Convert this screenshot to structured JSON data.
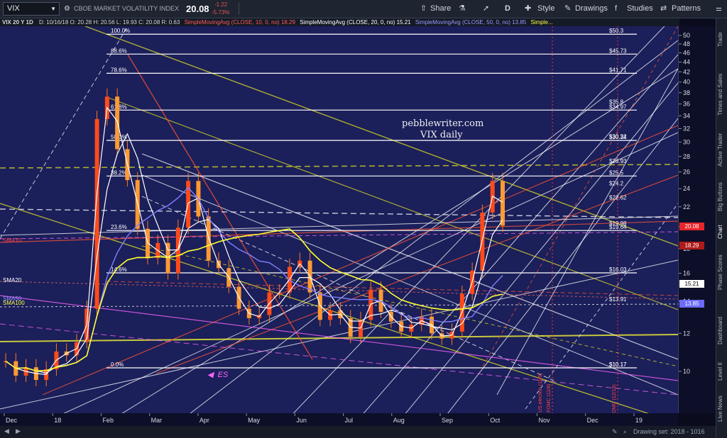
{
  "toolbar": {
    "symbol": "VIX",
    "description": "CBOE MARKET VOLATILITY INDEX",
    "last": "20.08",
    "change": "-1.22",
    "change_pct": "-5.73%",
    "share_label": "Share",
    "interval": "D",
    "style_label": "Style",
    "drawings_label": "Drawings",
    "studies_label": "Studies",
    "patterns_label": "Patterns"
  },
  "info_bar": {
    "chart_id": "VIX 20 Y 1D",
    "ohlc": "D: 10/16/18  O: 20.28  H: 20.56  L: 19.93  C: 20.08  R: 0.63",
    "sma10_label": "SimpleMovingAvg (CLOSE, 10, 0, no)",
    "sma10_value": "18.29",
    "sma20_label": "SimpleMovingAvg (CLOSE, 20, 0, no)",
    "sma20_value": "15.21",
    "sma50_label": "SimpleMovingAvg (CLOSE, 50, 0, no)",
    "sma50_value": "13.85",
    "sma100_label": "Simple..."
  },
  "watermark": {
    "line1": "pebblewriter.com",
    "line2": "VIX daily"
  },
  "price_tags": {
    "close": "20.08",
    "sma10": "18.29",
    "sma20": "15.21",
    "sma50": "13.85"
  },
  "sma_labels": [
    "SMA10",
    "SMA20",
    "SMA50",
    "SMA100"
  ],
  "fib_left": [
    "100.0%",
    "88.6%",
    "78.6%",
    "61.8%",
    "50.0%",
    "38.2%",
    "23.6%",
    "14.6%",
    "0.0%"
  ],
  "fib_right": [
    "$50.3",
    "$45.73",
    "$41.71",
    "$35.8",
    "$34.97",
    "$30.32",
    "$30.24",
    "$26.93",
    "$25.5",
    "$24.2",
    "$22.62",
    "$19.98",
    "$19.64",
    "$16.03",
    "$13.91",
    "$10.17",
    "$10.17"
  ],
  "annotations": {
    "es": "ES",
    "fomc1": "FOMC (11/8)",
    "fomc2": "FOMC (12/19)",
    "election": "US election (11/6)"
  },
  "bottom": {
    "drawing_set": "Drawing set: 2018 - 1016"
  },
  "sidebar": [
    "Trade",
    "Times and Sales",
    "Active Trader",
    "Big Buttons",
    "Chart",
    "Phase Scores",
    "Dashboard",
    "Level II",
    "Live News"
  ],
  "colors": {
    "background": "#1b1f5a",
    "candle_up": "#ff4a1a",
    "candle_down": "#ff7a1a",
    "sma10": "#ffffff",
    "sma20": "#ffffff",
    "sma50": "#8080ff",
    "sma100": "#ffff33",
    "fib": "#ffffff",
    "channel_yellow": "#dddd22",
    "channel_red": "#ff5533",
    "magenta": "#ff66ff"
  },
  "chart_data": {
    "type": "line",
    "title": "VIX 20 Y 1D",
    "ylim": [
      2,
      51
    ],
    "y_ticks": [
      50,
      48,
      46,
      44,
      42,
      40,
      38,
      36,
      34,
      32,
      30,
      28,
      26,
      24,
      22,
      20,
      18,
      16,
      14,
      12,
      10
    ],
    "y_scale": "log",
    "x_ticks": [
      "Dec",
      "18",
      "Feb",
      "Mar",
      "Apr",
      "May",
      "Jun",
      "Jul",
      "Aug",
      "Sep",
      "Oct",
      "Nov",
      "Dec",
      "19"
    ],
    "series": [
      {
        "name": "VIX",
        "values": [
          10.5,
          9.8,
          10.2,
          9.6,
          10.1,
          11.0,
          10.8,
          11.5,
          13.5,
          33.5,
          37.3,
          29.0,
          25.0,
          19.8,
          17.2,
          18.5,
          16.0,
          19.9,
          24.9,
          21.0,
          17.0,
          16.4,
          15.0,
          13.5,
          12.9,
          13.1,
          14.6,
          14.6,
          16.5,
          17.0,
          14.6,
          12.8,
          13.4,
          12.9,
          11.8,
          12.8,
          14.8,
          13.3,
          12.7,
          12.1,
          12.5,
          13.0,
          12.0,
          11.7,
          12.1,
          14.5,
          16.2,
          21.4,
          24.9,
          20.1
        ]
      }
    ],
    "fib_levels": [
      {
        "label": "100.0%",
        "value": 50.3
      },
      {
        "label": "88.6%",
        "value": 45.73
      },
      {
        "label": "78.6%",
        "value": 41.71
      },
      {
        "label": "61.8%",
        "value": 34.97
      },
      {
        "label": "50.0%",
        "value": 30.24
      },
      {
        "label": "38.2%",
        "value": 25.5
      },
      {
        "label": "23.6%",
        "value": 19.64
      },
      {
        "label": "14.6%",
        "value": 16.03
      },
      {
        "label": "0.0%",
        "value": 10.17
      }
    ]
  }
}
